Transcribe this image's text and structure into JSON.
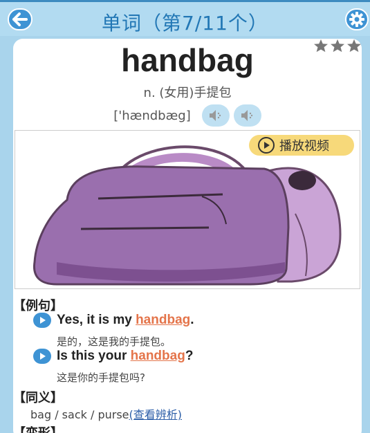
{
  "header": {
    "title": "单词（第7/11个）",
    "back_icon": "back-arrow-icon",
    "settings_icon": "gear-icon"
  },
  "rating": {
    "stars": 3,
    "max": 3
  },
  "word": {
    "text": "handbag",
    "meaning": "n. (女用)手提包",
    "phonetic": "['hændbæg]"
  },
  "video_button": {
    "label": "播放视频"
  },
  "examples_section": {
    "title": "【例句】",
    "items": [
      {
        "before": "Yes, it is my ",
        "word": "handbag",
        "after": ".",
        "translation": "是的，这是我的手提包。"
      },
      {
        "before": "Is this your ",
        "word": "handbag",
        "after": "?",
        "translation": "这是你的手提包吗?"
      }
    ]
  },
  "synonyms_section": {
    "title": "【同义】",
    "text": "bag / sack / purse",
    "link": "(查看辨析)"
  },
  "forms_section": {
    "title": "【变形】"
  },
  "colors": {
    "accent": "#3e93d4",
    "title": "#2277b5",
    "highlight": "#e4744a",
    "video_btn": "#f7d97a"
  }
}
